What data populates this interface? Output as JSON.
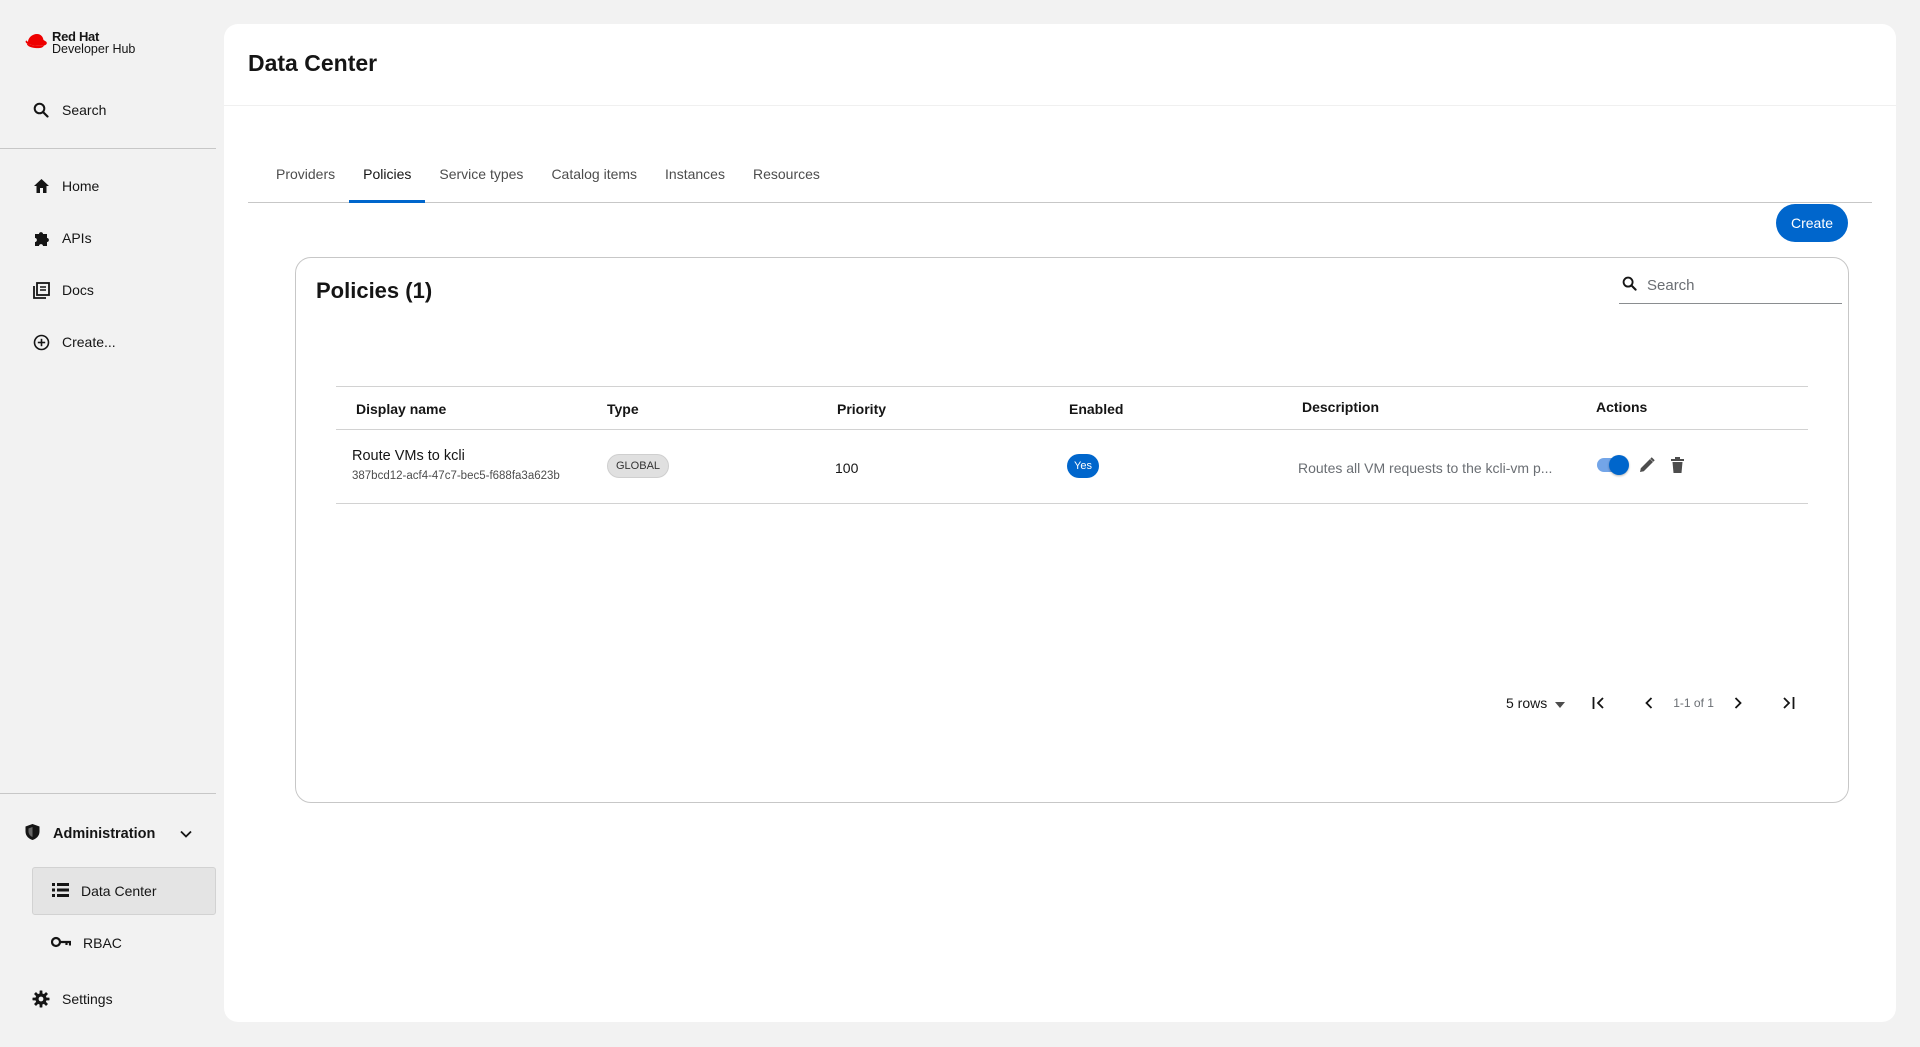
{
  "brand": {
    "line1": "Red Hat",
    "line2": "Developer Hub"
  },
  "sidebar": {
    "search_label": "Search",
    "items": [
      {
        "label": "Home",
        "icon": "home-icon"
      },
      {
        "label": "APIs",
        "icon": "puzzle-icon"
      },
      {
        "label": "Docs",
        "icon": "docs-icon"
      },
      {
        "label": "Create...",
        "icon": "add-circle-icon"
      }
    ],
    "admin": {
      "label": "Administration",
      "children": [
        {
          "label": "Data Center",
          "icon": "list-icon",
          "active": true
        },
        {
          "label": "RBAC",
          "icon": "key-icon",
          "active": false
        }
      ]
    },
    "settings_label": "Settings"
  },
  "page": {
    "title": "Data Center",
    "tabs": [
      "Providers",
      "Policies",
      "Service types",
      "Catalog items",
      "Instances",
      "Resources"
    ],
    "active_tab": "Policies",
    "create_label": "Create"
  },
  "card": {
    "title": "Policies (1)",
    "search_placeholder": "Search",
    "columns": [
      "Display name",
      "Type",
      "Priority",
      "Enabled",
      "Description",
      "Actions"
    ],
    "rows": [
      {
        "name": "Route VMs to kcli",
        "id": "387bcd12-acf4-47c7-bec5-f688fa3a623b",
        "type": "GLOBAL",
        "priority": "100",
        "enabled": "Yes",
        "description": "Routes all VM requests to the kcli-vm p..."
      }
    ],
    "pagination": {
      "rows_label": "5 rows",
      "range": "1-1 of 1"
    }
  },
  "colors": {
    "accent": "#0066cc",
    "page_bg": "#f2f2f2",
    "brand_red": "#ee0000"
  }
}
